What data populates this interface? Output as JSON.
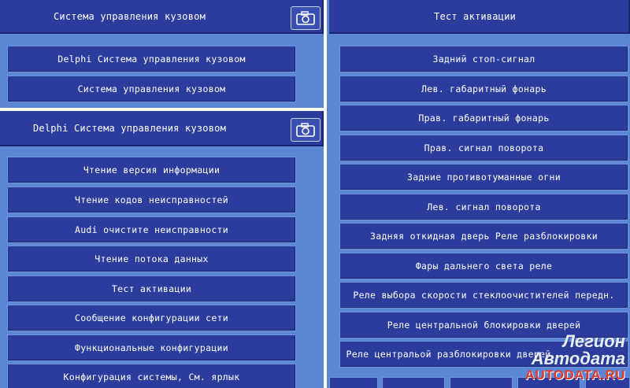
{
  "top_left": {
    "title": "Система управления кузовом",
    "items": [
      "Delphi Система управления кузовом",
      "Система управления кузовом"
    ]
  },
  "bottom_left": {
    "title": "Delphi Система управления кузовом",
    "items": [
      "Чтение версия информации",
      "Чтение кодов неисправностей",
      "Audi очистите неисправности",
      "Чтение потока данных",
      "Тест активации",
      "Сообщение конфигурации сети",
      "Функциональные конфигурации",
      "Конфигурация системы, См. ярлык"
    ]
  },
  "right": {
    "title": "Тест активации",
    "items": [
      "Задний стоп-сигнал",
      "Лев. габаритный фонарь",
      "Прав. габаритный фонарь",
      "Прав. сигнал поворота",
      "Задние противотуманные огни",
      "Лев. сигнал поворота",
      "Задняя откидная дверь Реле разблокировки",
      "Фары дальнего света реле",
      "Реле выбора скорости стеклоочистителей передн.",
      "Реле центральной блокировки дверей",
      "Реле центральой разблокировки дверей"
    ]
  },
  "watermark": {
    "line1": "Легион Автодата",
    "line2": "AUTODATA.RU"
  },
  "icons": {
    "camera": "camera-icon"
  },
  "colors": {
    "panel_bg": "#5a86d4",
    "button_bg": "#2b3c9c",
    "watermark_red": "#e23a2a"
  }
}
